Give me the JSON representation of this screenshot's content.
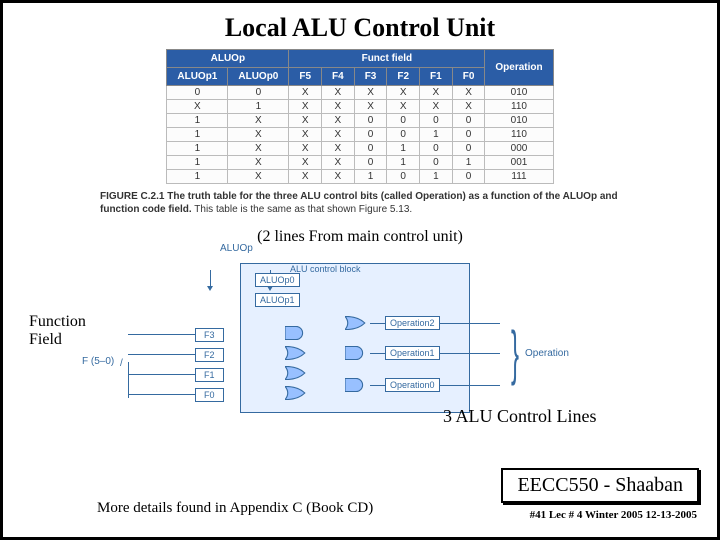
{
  "title": "Local ALU Control Unit",
  "truth_table": {
    "top_headers": [
      "ALUOp",
      "Funct field",
      "Operation"
    ],
    "sub_headers": [
      "ALUOp1",
      "ALUOp0",
      "F5",
      "F4",
      "F3",
      "F2",
      "F1",
      "F0"
    ],
    "rows": [
      [
        "0",
        "0",
        "X",
        "X",
        "X",
        "X",
        "X",
        "X",
        "010"
      ],
      [
        "X",
        "1",
        "X",
        "X",
        "X",
        "X",
        "X",
        "X",
        "110"
      ],
      [
        "1",
        "X",
        "X",
        "X",
        "0",
        "0",
        "0",
        "0",
        "010"
      ],
      [
        "1",
        "X",
        "X",
        "X",
        "0",
        "0",
        "1",
        "0",
        "110"
      ],
      [
        "1",
        "X",
        "X",
        "X",
        "0",
        "1",
        "0",
        "0",
        "000"
      ],
      [
        "1",
        "X",
        "X",
        "X",
        "0",
        "1",
        "0",
        "1",
        "001"
      ],
      [
        "1",
        "X",
        "X",
        "X",
        "1",
        "0",
        "1",
        "0",
        "111"
      ]
    ]
  },
  "caption": {
    "bold": "FIGURE C.2.1   The truth table for the three ALU control bits (called Operation) as a function of the ALUOp and function code field.",
    "rest": " This table is the same as that shown Figure 5.13."
  },
  "ann_from_main": "(2 lines From main control unit)",
  "circuit": {
    "aluop": "ALUOp",
    "block_label": "ALU control block",
    "aluop0": "ALUOp0",
    "aluop1": "ALUOp1",
    "f_input": "F (5–0)",
    "f3": "F3",
    "f2": "F2",
    "f1": "F1",
    "f0": "F0",
    "op2": "Operation2",
    "op1": "Operation1",
    "op0": "Operation0",
    "operation": "Operation"
  },
  "ann_func": "Function\nField",
  "ann_3alu": "3 ALU Control Lines",
  "footer_box": "EECC550 - Shaaban",
  "footer_line": "#41   Lec # 4   Winter 2005   12-13-2005",
  "more_details": "More details found in Appendix C (Book CD)"
}
